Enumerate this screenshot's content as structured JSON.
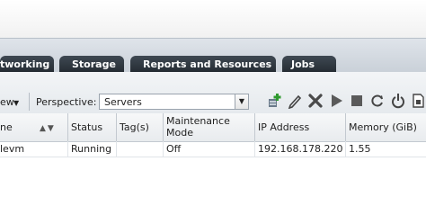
{
  "tabs": [
    {
      "label": "tworking"
    },
    {
      "label": "Storage"
    },
    {
      "label": "Reports and Resources"
    },
    {
      "label": "Jobs"
    }
  ],
  "toolbar": {
    "view_label": "ew",
    "perspective_label": "Perspective:",
    "perspective_value": "Servers",
    "buttons": [
      "add-server-icon",
      "edit-icon",
      "delete-icon",
      "start-icon",
      "stop-icon",
      "refresh-icon",
      "power-icon",
      "backup-icon"
    ]
  },
  "columns": [
    {
      "label": "ne"
    },
    {
      "label": "Status"
    },
    {
      "label": "Tag(s)"
    },
    {
      "label": "Maintenance\nMode"
    },
    {
      "label": "IP Address"
    },
    {
      "label": "Memory (GiB)"
    }
  ],
  "rows": [
    {
      "name": "levm",
      "status": "Running",
      "tags": "",
      "maintenance": "Off",
      "ip": "192.168.178.220",
      "memory": "1.55"
    }
  ],
  "colors": {
    "tab_bg": "#2f3841",
    "tabbar_bg": "#d4dae1",
    "delete_icon": "#4a4a4a"
  }
}
